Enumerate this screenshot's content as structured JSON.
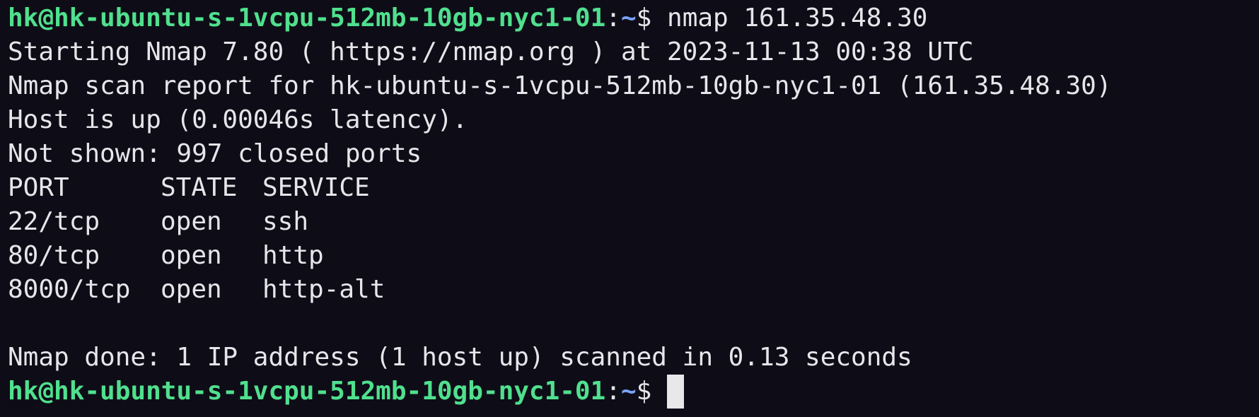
{
  "prompt": {
    "user_host": "hk@hk-ubuntu-s-1vcpu-512mb-10gb-nyc1-01",
    "colon": ":",
    "path": "~",
    "symbol": "$ "
  },
  "command": "nmap 161.35.48.30",
  "output": {
    "starting": "Starting Nmap 7.80 ( https://nmap.org ) at 2023-11-13 00:38 UTC",
    "scan_report": "Nmap scan report for hk-ubuntu-s-1vcpu-512mb-10gb-nyc1-01 (161.35.48.30)",
    "host_up": "Host is up (0.00046s latency).",
    "not_shown": "Not shown: 997 closed ports",
    "table": {
      "headers": [
        "PORT",
        "STATE",
        "SERVICE"
      ],
      "rows": [
        [
          "22/tcp",
          "open",
          "ssh"
        ],
        [
          "80/tcp",
          "open",
          "http"
        ],
        [
          "8000/tcp",
          "open",
          "http-alt"
        ]
      ]
    },
    "done": "Nmap done: 1 IP address (1 host up) scanned in 0.13 seconds"
  },
  "colors": {
    "background": "#0e0d17",
    "foreground": "#e6e6ea",
    "user_host": "#50e08e",
    "path": "#7aa2f7",
    "cursor": "#e8e8ea"
  }
}
